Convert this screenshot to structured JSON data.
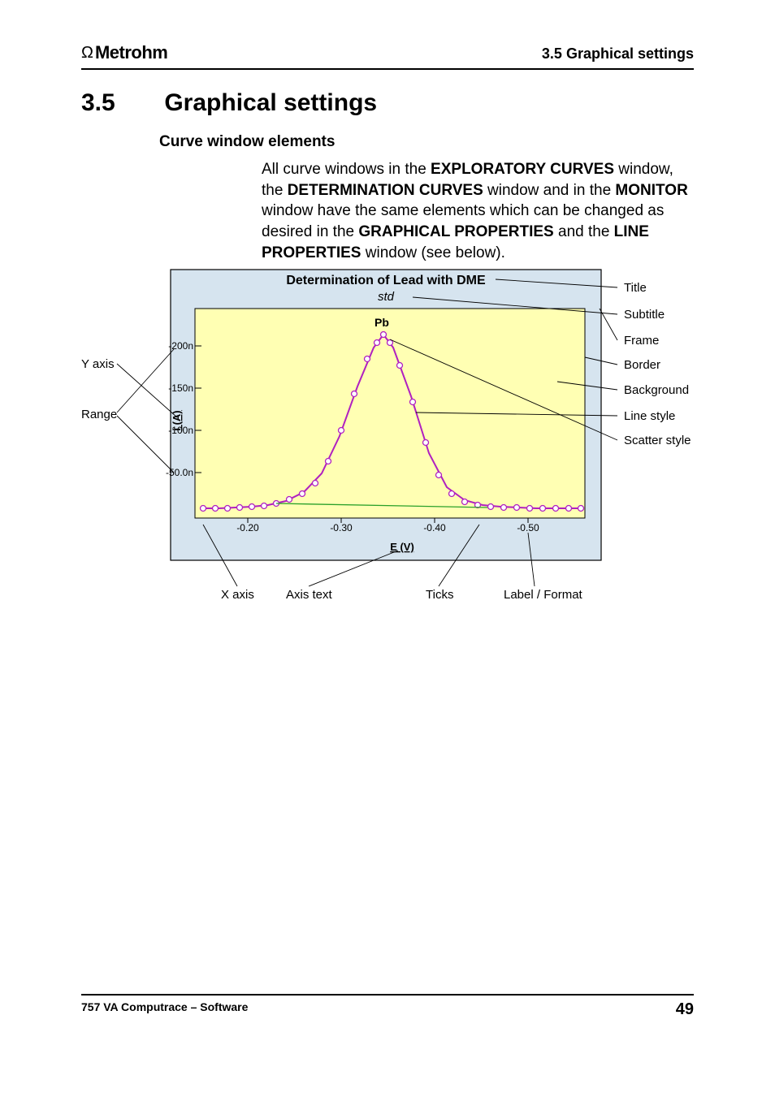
{
  "header": {
    "logo_text": "Metrohm",
    "right": "3.5  Graphical settings"
  },
  "section": {
    "number": "3.5",
    "title": "Graphical settings"
  },
  "subhead": "Curve window elements",
  "paragraph": {
    "t1": "All curve windows in the ",
    "b1": "EXPLORATORY CURVES",
    "t2": " window, the ",
    "b2": "DETERMINATION CURVES",
    "t3": " window and in the ",
    "b3": "MONITOR",
    "t4": " window have the same elements which can be changed as desired in the ",
    "b4": "GRAPHICAL PROPERTIES",
    "t5": " and the ",
    "b5": "LINE PROPERTIES",
    "t6": " window (see below)."
  },
  "figure": {
    "left_labels": {
      "yaxis": "Y axis",
      "range": "Range"
    },
    "right_labels": {
      "title": "Title",
      "subtitle": "Subtitle",
      "frame": "Frame",
      "border": "Border",
      "background": "Background",
      "line": "Line style",
      "scatter": "Scatter style"
    },
    "bottom_labels": {
      "xaxis": "X axis",
      "axistext": "Axis text",
      "ticks": "Ticks",
      "labelfmt": "Label / Format"
    },
    "chart": {
      "title": "Determination of Lead with DME",
      "subtitle": "std",
      "peak_label": "Pb",
      "x_axis_label": "E (V)",
      "y_axis_label": "i (A)",
      "x_ticks": [
        "-0.20",
        "-0.30",
        "-0.40",
        "-0.50"
      ],
      "y_ticks": [
        "-50.0n",
        "-100n",
        "-150n",
        "-200n"
      ]
    }
  },
  "footer": {
    "left": "757 VA Computrace – Software",
    "page": "49"
  },
  "chart_data": {
    "type": "line",
    "title": "Determination of Lead with DME",
    "subtitle": "std",
    "xlabel": "E (V)",
    "ylabel": "i (A)",
    "x_ticks": [
      -0.2,
      -0.3,
      -0.4,
      -0.5
    ],
    "y_ticks": [
      -5e-08,
      -1e-07,
      -1.5e-07,
      -2e-07
    ],
    "x_range": [
      -0.15,
      -0.55
    ],
    "y_range": [
      0,
      -2.2e-07
    ],
    "series": [
      {
        "name": "Pb",
        "peak_x": -0.37,
        "x": [
          -0.15,
          -0.18,
          -0.2,
          -0.22,
          -0.24,
          -0.26,
          -0.28,
          -0.3,
          -0.32,
          -0.34,
          -0.36,
          -0.37,
          -0.38,
          -0.4,
          -0.42,
          -0.44,
          -0.46,
          -0.48,
          -0.5,
          -0.52,
          -0.55
        ],
        "y": [
          -8e-09,
          -8e-09,
          -9e-09,
          -1e-08,
          -1.2e-08,
          -1.8e-08,
          -3e-08,
          -5.5e-08,
          -1.05e-07,
          -1.7e-07,
          -2.1e-07,
          -2.18e-07,
          -2.1e-07,
          -1.55e-07,
          -8.5e-08,
          -4e-08,
          -2.2e-08,
          -1.5e-08,
          -1.2e-08,
          -1.1e-08,
          -1e-08
        ]
      },
      {
        "name": "baseline",
        "x": [
          -0.15,
          -0.55
        ],
        "y": [
          -8e-09,
          -1.1e-08
        ]
      }
    ]
  }
}
